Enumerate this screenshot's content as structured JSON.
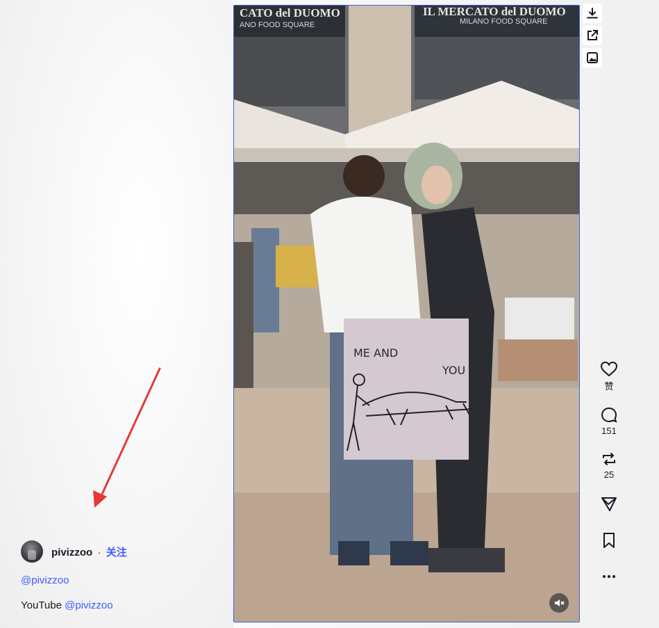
{
  "author": {
    "name": "pivizzoo",
    "separator": "·",
    "follow_label": "关注"
  },
  "description": {
    "handle_line": "@pivizzoo",
    "youtube_prefix": "YouTube",
    "youtube_handle": "@pivizzoo"
  },
  "video": {
    "sign_top_left": "CATO del DUOMO",
    "sign_sub_left": "ANO FOOD SQUARE",
    "sign_top_right": "IL MERCATO del DUOMO",
    "sign_sub_right": "MILANO FOOD SQUARE",
    "paper_text_me_and": "ME AND",
    "paper_text_you": "YOU"
  },
  "tools": {
    "download_icon": "download-icon",
    "open_external_icon": "open-external-icon",
    "image_icon": "image-icon"
  },
  "actions": {
    "like_label": "赞",
    "comment_count": "151",
    "repost_count": "25"
  },
  "colors": {
    "accent_blue": "#3d5afe",
    "video_border": "#3a62d6",
    "annotation_red": "#e53935"
  }
}
